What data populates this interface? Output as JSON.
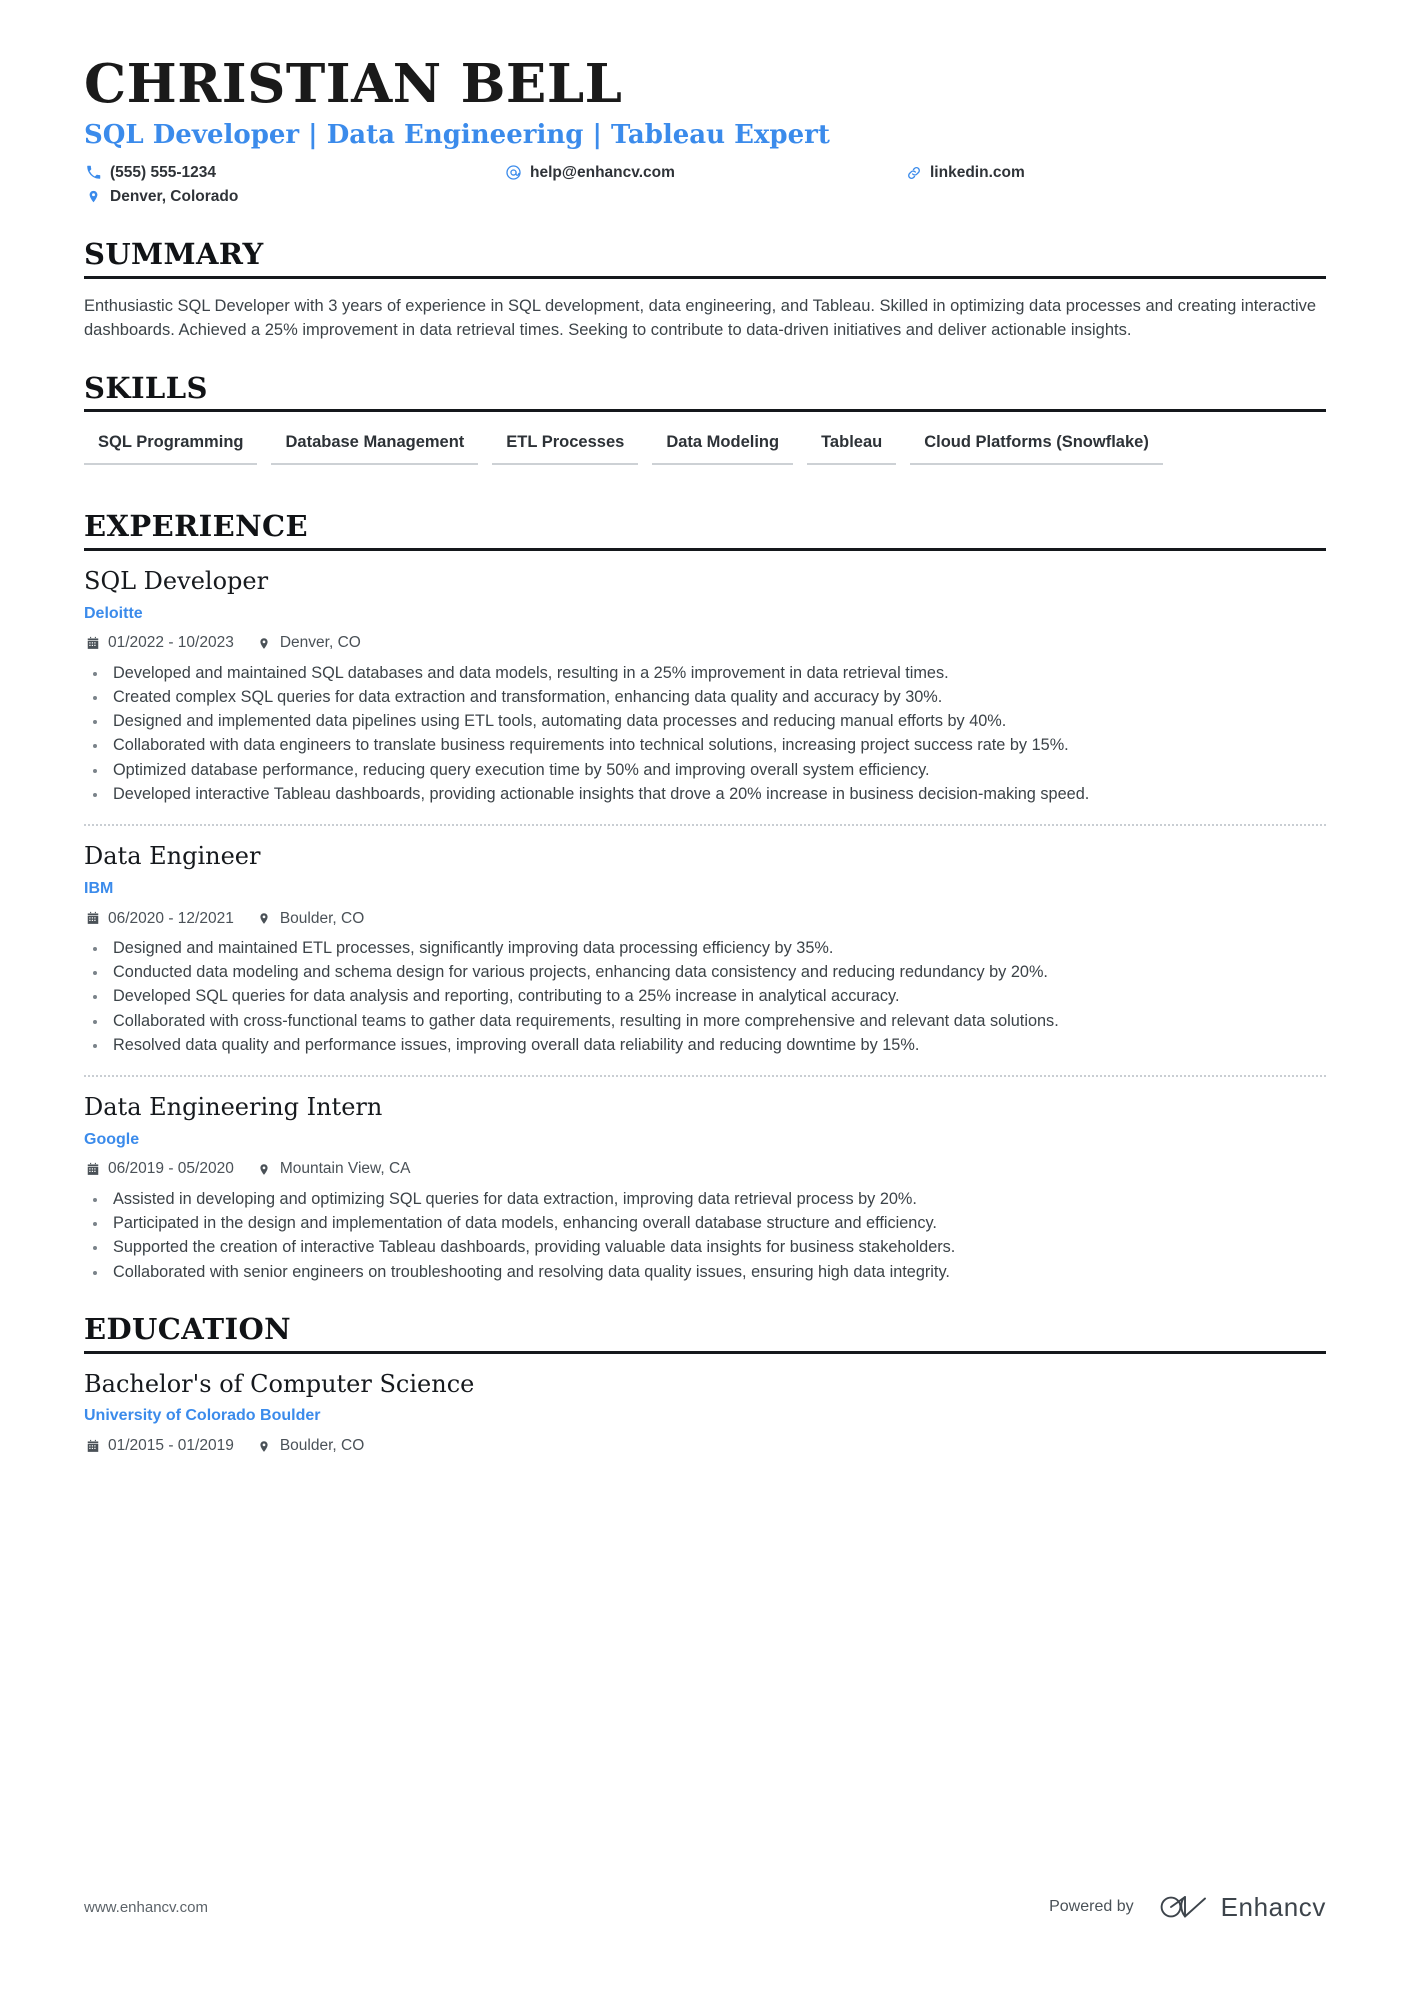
{
  "header": {
    "name": "CHRISTIAN BELL",
    "headline": "SQL Developer | Data Engineering | Tableau Expert",
    "accent_color": "#3b8beb",
    "contacts": [
      {
        "icon": "phone-icon",
        "text": "(555) 555-1234"
      },
      {
        "icon": "email-icon",
        "text": "help@enhancv.com"
      },
      {
        "icon": "link-icon",
        "text": "linkedin.com"
      },
      {
        "icon": "location-icon",
        "text": "Denver, Colorado"
      }
    ]
  },
  "summary": {
    "heading": "SUMMARY",
    "text": "Enthusiastic SQL Developer with 3 years of experience in SQL development, data engineering, and Tableau. Skilled in optimizing data processes and creating interactive dashboards. Achieved a 25% improvement in data retrieval times. Seeking to contribute to data-driven initiatives and deliver actionable insights."
  },
  "skills": {
    "heading": "SKILLS",
    "items": [
      "SQL Programming",
      "Database Management",
      "ETL Processes",
      "Data Modeling",
      "Tableau",
      "Cloud Platforms (Snowflake)"
    ]
  },
  "experience": {
    "heading": "EXPERIENCE",
    "entries": [
      {
        "title": "SQL Developer",
        "organization": "Deloitte",
        "dates": "01/2022 - 10/2023",
        "location": "Denver, CO",
        "bullets": [
          "Developed and maintained SQL databases and data models, resulting in a 25% improvement in data retrieval times.",
          "Created complex SQL queries for data extraction and transformation, enhancing data quality and accuracy by 30%.",
          "Designed and implemented data pipelines using ETL tools, automating data processes and reducing manual efforts by 40%.",
          "Collaborated with data engineers to translate business requirements into technical solutions, increasing project success rate by 15%.",
          "Optimized database performance, reducing query execution time by 50% and improving overall system efficiency.",
          "Developed interactive Tableau dashboards, providing actionable insights that drove a 20% increase in business decision-making speed."
        ]
      },
      {
        "title": "Data Engineer",
        "organization": "IBM",
        "dates": "06/2020 - 12/2021",
        "location": "Boulder, CO",
        "bullets": [
          "Designed and maintained ETL processes, significantly improving data processing efficiency by 35%.",
          "Conducted data modeling and schema design for various projects, enhancing data consistency and reducing redundancy by 20%.",
          "Developed SQL queries for data analysis and reporting, contributing to a 25% increase in analytical accuracy.",
          "Collaborated with cross-functional teams to gather data requirements, resulting in more comprehensive and relevant data solutions.",
          "Resolved data quality and performance issues, improving overall data reliability and reducing downtime by 15%."
        ]
      },
      {
        "title": "Data Engineering Intern",
        "organization": "Google",
        "dates": "06/2019 - 05/2020",
        "location": "Mountain View, CA",
        "bullets": [
          "Assisted in developing and optimizing SQL queries for data extraction, improving data retrieval process by 20%.",
          "Participated in the design and implementation of data models, enhancing overall database structure and efficiency.",
          "Supported the creation of interactive Tableau dashboards, providing valuable data insights for business stakeholders.",
          "Collaborated with senior engineers on troubleshooting and resolving data quality issues, ensuring high data integrity."
        ]
      }
    ]
  },
  "education": {
    "heading": "EDUCATION",
    "entries": [
      {
        "title": "Bachelor's of Computer Science",
        "organization": "University of Colorado Boulder",
        "dates": "01/2015 - 01/2019",
        "location": "Boulder, CO"
      }
    ]
  },
  "footer": {
    "url": "www.enhancv.com",
    "powered_by": "Powered by",
    "brand": "Enhancv"
  }
}
